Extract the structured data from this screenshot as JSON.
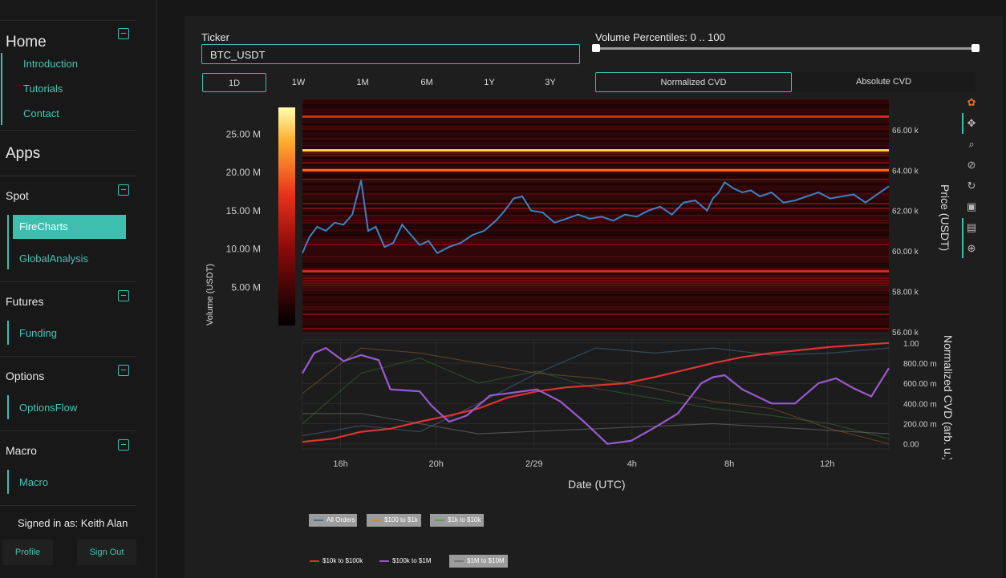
{
  "sidebar": {
    "home": {
      "title": "Home",
      "links": [
        "Introduction",
        "Tutorials",
        "Contact"
      ]
    },
    "apps_title": "Apps",
    "spot": {
      "title": "Spot",
      "links": [
        "FireCharts",
        "GlobalAnalysis"
      ],
      "active": "FireCharts"
    },
    "futures": {
      "title": "Futures",
      "links": [
        "Funding"
      ]
    },
    "options": {
      "title": "Options",
      "links": [
        "OptionsFlow"
      ]
    },
    "macro": {
      "title": "Macro",
      "links": [
        "Macro"
      ]
    },
    "signed_in": "Signed in as: Keith Alan",
    "profile_label": "Profile",
    "signout_label": "Sign Out"
  },
  "controls": {
    "ticker_label": "Ticker",
    "ticker_value": "BTC_USDT",
    "percentile_label": "Volume Percentiles: 0 .. 100",
    "timeframes": [
      "1D",
      "1W",
      "1M",
      "6M",
      "1Y",
      "3Y"
    ],
    "active_timeframe": "1D",
    "cvd_modes": [
      "Normalized CVD",
      "Absolute CVD"
    ],
    "active_cvd": "Normalized CVD"
  },
  "chart_data": [
    {
      "type": "heatmap",
      "title": "",
      "xlabel": "",
      "ylabel": "Price (USDT)",
      "colorbar_label": "Volume (USDT)",
      "colorbar_ticks": [
        "25.00 M",
        "20.00 M",
        "15.00 M",
        "10.00 M",
        "5.00 M"
      ],
      "y_ticks": [
        "66.00 k",
        "64.00 k",
        "62.00 k",
        "60.00 k",
        "58.00 k",
        "56.00 k"
      ],
      "ylim": [
        56000,
        67500
      ],
      "price_series": {
        "color": "#3b82c4",
        "points": [
          [
            0,
            59900
          ],
          [
            0.012,
            60700
          ],
          [
            0.025,
            61200
          ],
          [
            0.04,
            61000
          ],
          [
            0.055,
            61400
          ],
          [
            0.07,
            61300
          ],
          [
            0.085,
            61800
          ],
          [
            0.1,
            63500
          ],
          [
            0.112,
            61000
          ],
          [
            0.125,
            61200
          ],
          [
            0.14,
            60200
          ],
          [
            0.155,
            60400
          ],
          [
            0.17,
            61300
          ],
          [
            0.185,
            60800
          ],
          [
            0.2,
            60300
          ],
          [
            0.215,
            60500
          ],
          [
            0.23,
            59900
          ],
          [
            0.25,
            60200
          ],
          [
            0.27,
            60400
          ],
          [
            0.29,
            60800
          ],
          [
            0.31,
            61000
          ],
          [
            0.33,
            61500
          ],
          [
            0.345,
            62000
          ],
          [
            0.36,
            62600
          ],
          [
            0.375,
            62700
          ],
          [
            0.39,
            62000
          ],
          [
            0.41,
            61900
          ],
          [
            0.43,
            61400
          ],
          [
            0.45,
            61600
          ],
          [
            0.47,
            61800
          ],
          [
            0.49,
            61600
          ],
          [
            0.51,
            61700
          ],
          [
            0.53,
            61500
          ],
          [
            0.55,
            61800
          ],
          [
            0.57,
            61700
          ],
          [
            0.59,
            62000
          ],
          [
            0.61,
            62200
          ],
          [
            0.63,
            61800
          ],
          [
            0.65,
            62400
          ],
          [
            0.67,
            62500
          ],
          [
            0.69,
            62000
          ],
          [
            0.7,
            62600
          ],
          [
            0.71,
            62900
          ],
          [
            0.72,
            63400
          ],
          [
            0.735,
            63100
          ],
          [
            0.75,
            62900
          ],
          [
            0.765,
            63000
          ],
          [
            0.78,
            62700
          ],
          [
            0.8,
            62900
          ],
          [
            0.82,
            62400
          ],
          [
            0.84,
            62500
          ],
          [
            0.86,
            62700
          ],
          [
            0.88,
            62900
          ],
          [
            0.9,
            62600
          ],
          [
            0.92,
            62700
          ],
          [
            0.94,
            62800
          ],
          [
            0.96,
            62400
          ],
          [
            0.98,
            62800
          ],
          [
            1,
            63200
          ]
        ]
      },
      "bright_levels": [
        {
          "price": 64980,
          "color": "#ffd24a"
        },
        {
          "price": 64000,
          "color": "#ff6a1a"
        },
        {
          "price": 66650,
          "color": "#d42a1a"
        },
        {
          "price": 59000,
          "color": "#c9321c"
        }
      ]
    },
    {
      "type": "line",
      "title": "",
      "xlabel": "Date (UTC)",
      "ylabel": "Normalized CVD (arb. u.)",
      "x_ticks": [
        "16h",
        "20h",
        "2/29",
        "4h",
        "8h",
        "12h"
      ],
      "y_ticks": [
        "1.00",
        "800.00 m",
        "600.00 m",
        "400.00 m",
        "200.00 m",
        "0.00"
      ],
      "ylim": [
        -0.05,
        1.03
      ],
      "series": [
        {
          "name": "All Orders",
          "visible": false,
          "color": "#4a6e8a",
          "values": [
            [
              0,
              0.08
            ],
            [
              0.1,
              0.18
            ],
            [
              0.2,
              0.12
            ],
            [
              0.3,
              0.4
            ],
            [
              0.4,
              0.7
            ],
            [
              0.5,
              0.95
            ],
            [
              0.6,
              0.9
            ],
            [
              0.7,
              0.95
            ],
            [
              0.8,
              0.88
            ],
            [
              0.9,
              0.9
            ],
            [
              1,
              0.95
            ]
          ]
        },
        {
          "name": "$100 to $1k",
          "visible": false,
          "color": "#8a5a2a",
          "values": [
            [
              0,
              0.5
            ],
            [
              0.1,
              0.95
            ],
            [
              0.2,
              0.9
            ],
            [
              0.3,
              0.8
            ],
            [
              0.4,
              0.7
            ],
            [
              0.5,
              0.65
            ],
            [
              0.6,
              0.55
            ],
            [
              0.7,
              0.42
            ],
            [
              0.8,
              0.35
            ],
            [
              0.9,
              0.15
            ],
            [
              1,
              0.0
            ]
          ]
        },
        {
          "name": "$1k to $10k",
          "visible": false,
          "color": "#3a6a3a",
          "values": [
            [
              0,
              0.2
            ],
            [
              0.1,
              0.7
            ],
            [
              0.2,
              0.85
            ],
            [
              0.3,
              0.6
            ],
            [
              0.4,
              0.72
            ],
            [
              0.5,
              0.55
            ],
            [
              0.6,
              0.45
            ],
            [
              0.7,
              0.35
            ],
            [
              0.8,
              0.28
            ],
            [
              0.9,
              0.2
            ],
            [
              1,
              0.05
            ]
          ]
        },
        {
          "name": "$10k to $100k",
          "visible": true,
          "color": "#e03232",
          "values": [
            [
              0,
              0.02
            ],
            [
              0.05,
              0.05
            ],
            [
              0.1,
              0.12
            ],
            [
              0.15,
              0.15
            ],
            [
              0.2,
              0.22
            ],
            [
              0.25,
              0.28
            ],
            [
              0.3,
              0.35
            ],
            [
              0.35,
              0.46
            ],
            [
              0.4,
              0.52
            ],
            [
              0.45,
              0.56
            ],
            [
              0.5,
              0.58
            ],
            [
              0.55,
              0.6
            ],
            [
              0.6,
              0.66
            ],
            [
              0.65,
              0.73
            ],
            [
              0.7,
              0.8
            ],
            [
              0.75,
              0.86
            ],
            [
              0.8,
              0.9
            ],
            [
              0.85,
              0.93
            ],
            [
              0.9,
              0.96
            ],
            [
              0.95,
              0.98
            ],
            [
              1,
              1.0
            ]
          ]
        },
        {
          "name": "$100k to $1M",
          "visible": true,
          "color": "#9b59d0",
          "values": [
            [
              0,
              0.7
            ],
            [
              0.02,
              0.9
            ],
            [
              0.04,
              0.95
            ],
            [
              0.07,
              0.82
            ],
            [
              0.1,
              0.88
            ],
            [
              0.13,
              0.83
            ],
            [
              0.15,
              0.54
            ],
            [
              0.2,
              0.52
            ],
            [
              0.22,
              0.38
            ],
            [
              0.25,
              0.22
            ],
            [
              0.28,
              0.28
            ],
            [
              0.32,
              0.48
            ],
            [
              0.35,
              0.5
            ],
            [
              0.4,
              0.54
            ],
            [
              0.44,
              0.42
            ],
            [
              0.48,
              0.22
            ],
            [
              0.52,
              0.0
            ],
            [
              0.56,
              0.03
            ],
            [
              0.6,
              0.16
            ],
            [
              0.64,
              0.3
            ],
            [
              0.68,
              0.6
            ],
            [
              0.7,
              0.66
            ],
            [
              0.72,
              0.68
            ],
            [
              0.75,
              0.54
            ],
            [
              0.8,
              0.4
            ],
            [
              0.84,
              0.4
            ],
            [
              0.88,
              0.6
            ],
            [
              0.91,
              0.65
            ],
            [
              0.94,
              0.55
            ],
            [
              0.97,
              0.47
            ],
            [
              1,
              0.75
            ]
          ]
        },
        {
          "name": "$1M to $10M",
          "visible": false,
          "color": "#777777",
          "values": [
            [
              0,
              0.3
            ],
            [
              0.1,
              0.3
            ],
            [
              0.3,
              0.1
            ],
            [
              0.5,
              0.15
            ],
            [
              0.7,
              0.2
            ],
            [
              1,
              0.1
            ]
          ]
        }
      ]
    }
  ]
}
